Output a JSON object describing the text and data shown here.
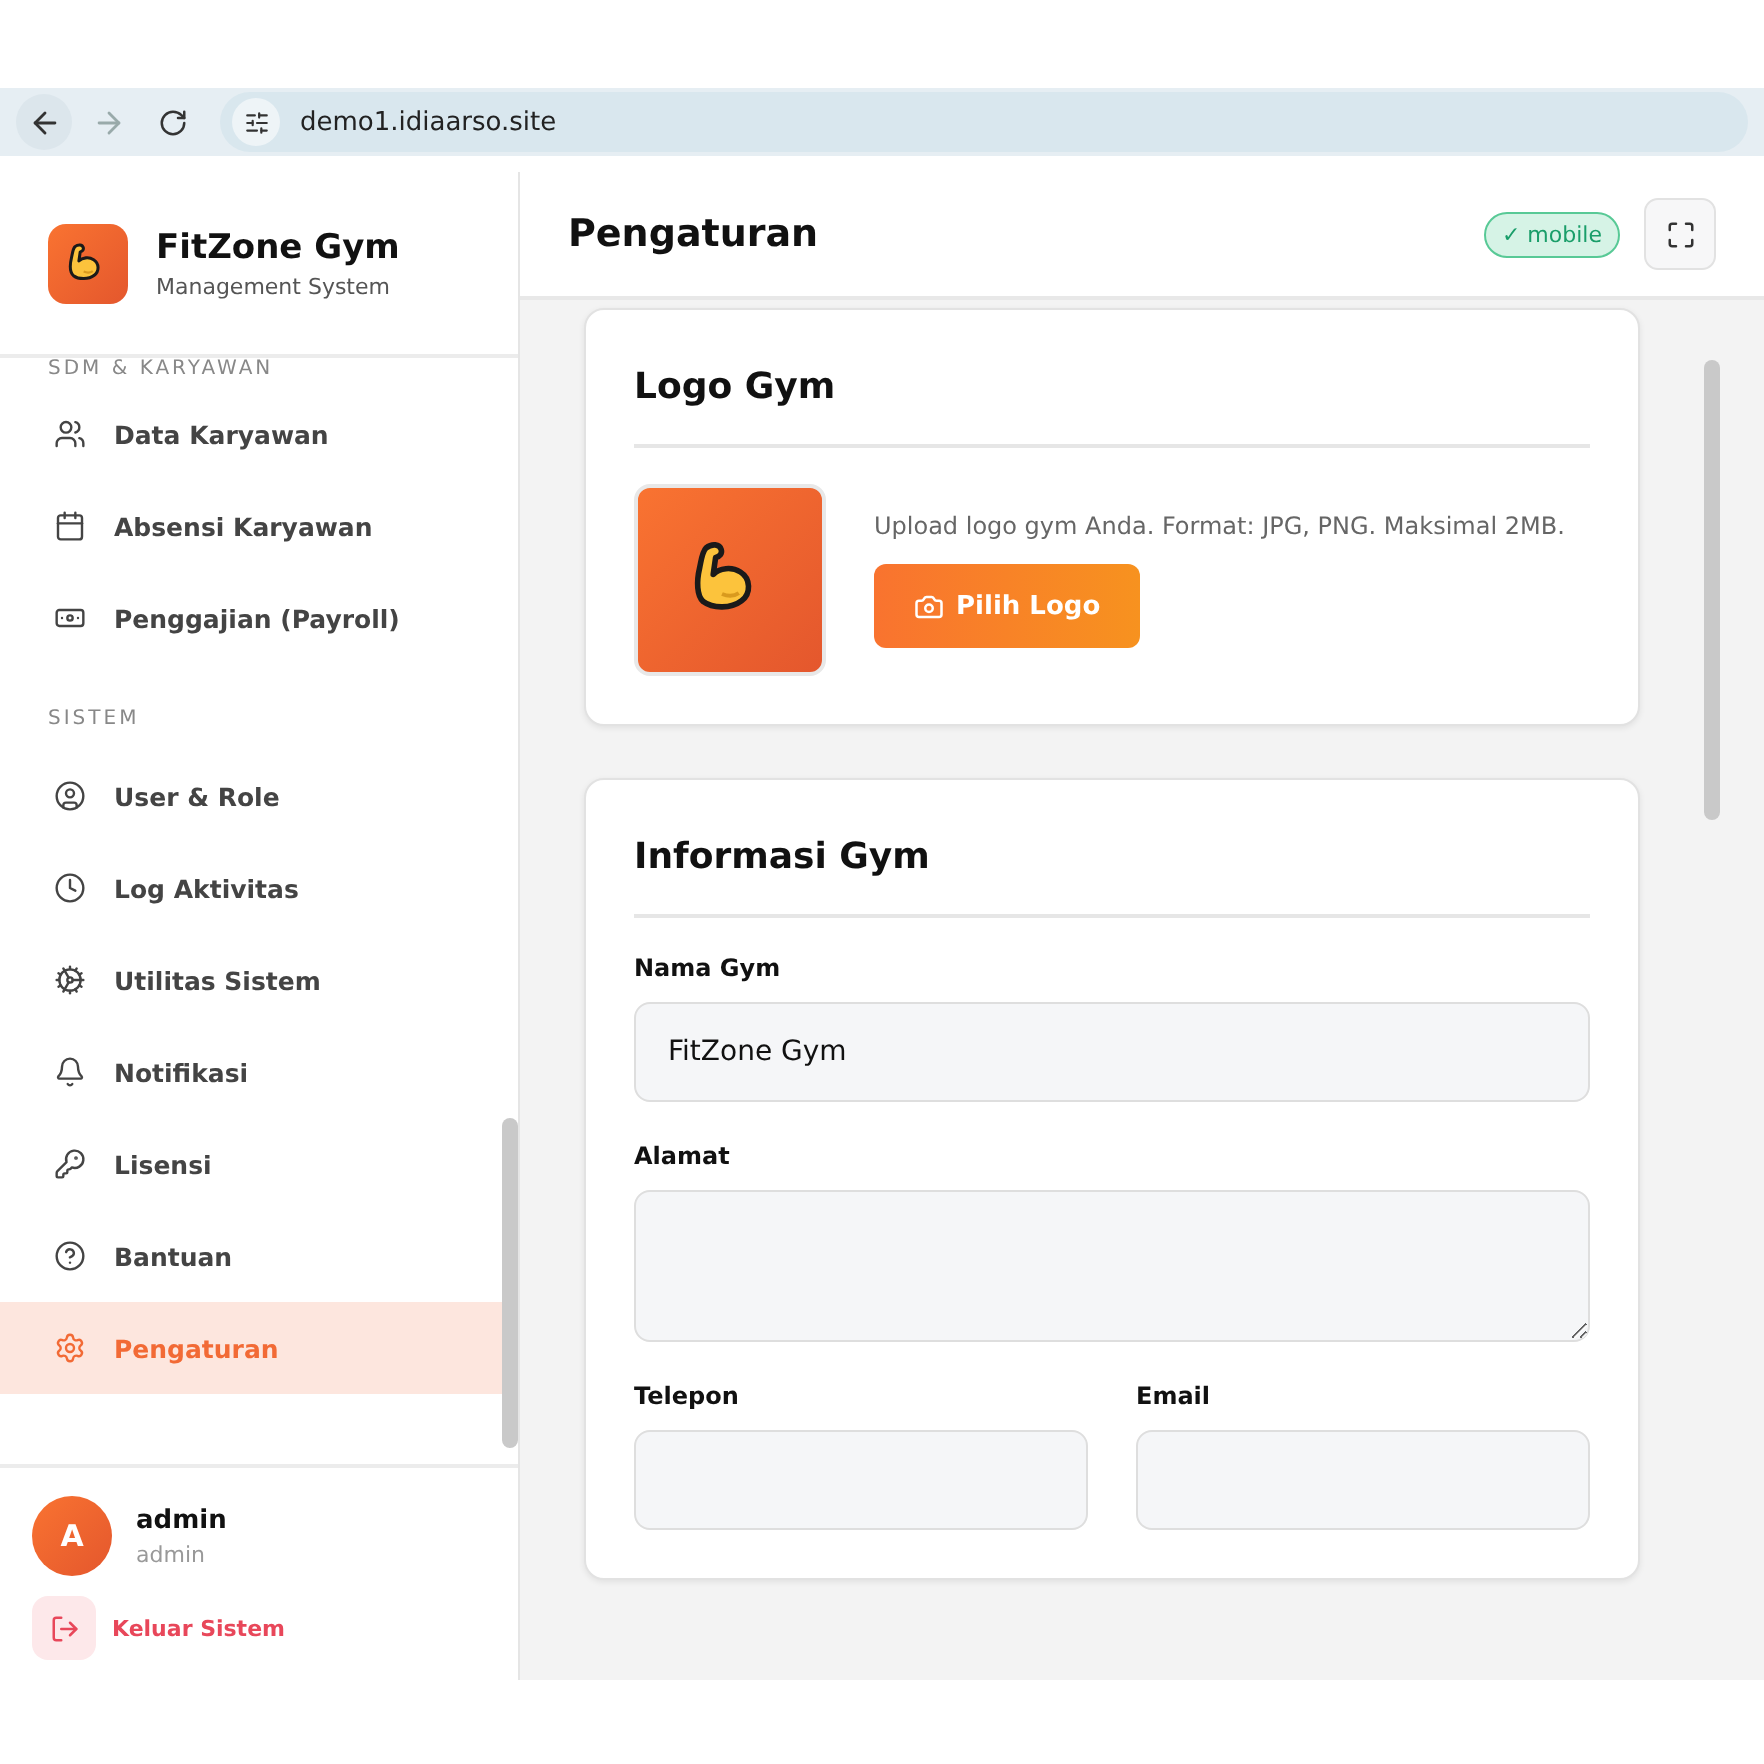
{
  "browser": {
    "url": "demo1.idiaarso.site"
  },
  "brand": {
    "name": "FitZone Gym",
    "subtitle": "Management System"
  },
  "sidebar": {
    "sections": [
      {
        "title": "SDM & KARYAWAN",
        "items": [
          {
            "label": "Data Karyawan",
            "selected": false
          },
          {
            "label": "Absensi Karyawan",
            "selected": false
          },
          {
            "label": "Penggajian (Payroll)",
            "selected": false
          }
        ]
      },
      {
        "title": "SISTEM",
        "items": [
          {
            "label": "User & Role",
            "selected": false
          },
          {
            "label": "Log Aktivitas",
            "selected": false
          },
          {
            "label": "Utilitas Sistem",
            "selected": false
          },
          {
            "label": "Notifikasi",
            "selected": false
          },
          {
            "label": "Lisensi",
            "selected": false
          },
          {
            "label": "Bantuan",
            "selected": false
          },
          {
            "label": "Pengaturan",
            "selected": true
          }
        ]
      }
    ]
  },
  "user": {
    "initial": "A",
    "name": "admin",
    "role": "admin"
  },
  "logout": {
    "label": "Keluar Sistem"
  },
  "page": {
    "title": "Pengaturan",
    "badge": "✓ mobile"
  },
  "logo_card": {
    "title": "Logo Gym",
    "hint": "Upload logo gym Anda. Format: JPG, PNG. Maksimal 2MB.",
    "button": "Pilih Logo"
  },
  "info_card": {
    "title": "Informasi Gym",
    "fields": [
      {
        "kind": "input",
        "label": "Nama Gym",
        "value": "FitZone Gym"
      },
      {
        "kind": "textarea",
        "label": "Alamat"
      },
      {
        "kind": "half",
        "label": "Telepon"
      },
      {
        "kind": "half",
        "label": "Email"
      }
    ]
  }
}
